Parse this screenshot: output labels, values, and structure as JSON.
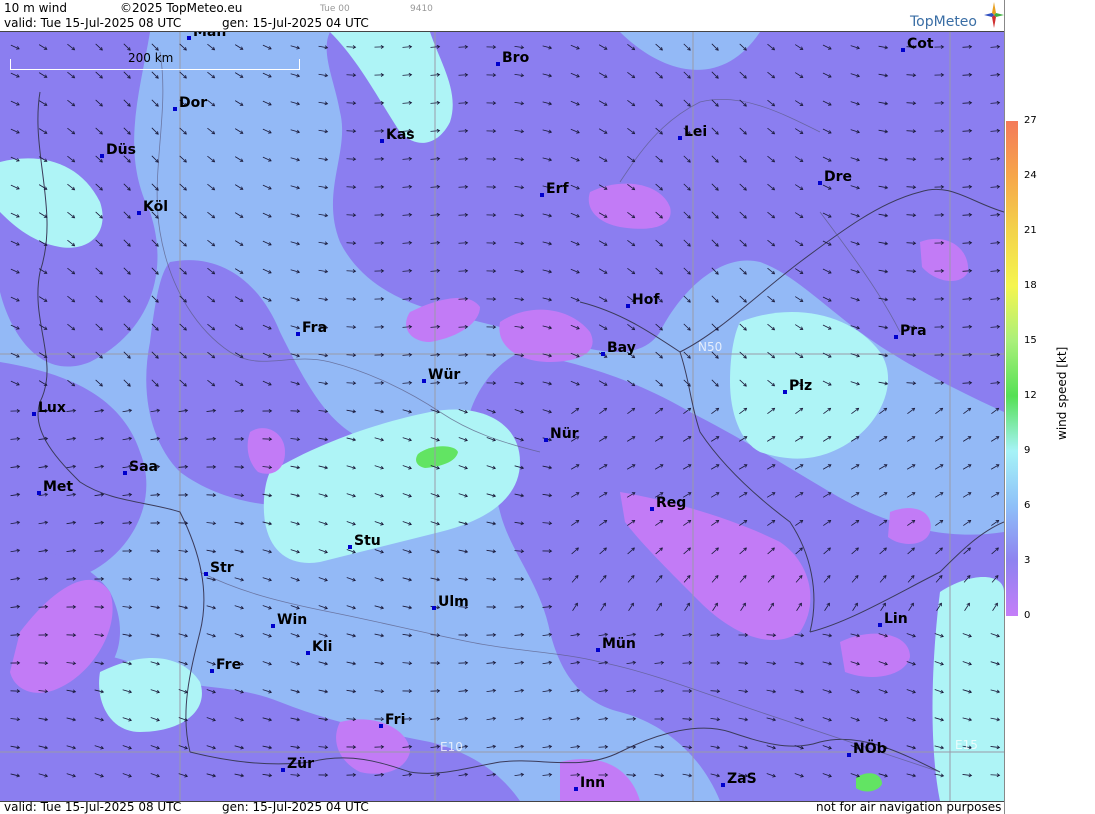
{
  "header": {
    "title": "10 m wind",
    "copyright": "©2025 TopMeteo.eu",
    "run": "Tue 00",
    "code": "9410",
    "valid": "valid:  Tue  15-Jul-2025  08 UTC",
    "gen": "gen: 15-Jul-2025 04 UTC"
  },
  "logo": {
    "text": "TopMeteo"
  },
  "footer": {
    "valid": "valid:  Tue  15-Jul-2025  08 UTC",
    "gen": "gen: 15-Jul-2025 04 UTC",
    "disclaimer": "not for air navigation purposes"
  },
  "scale_label": "200 km",
  "grid_labels": {
    "n50": "N50",
    "e10": "E10",
    "e15": "E15"
  },
  "cities": [
    {
      "name": "Man"
    },
    {
      "name": "Bro"
    },
    {
      "name": "Cot"
    },
    {
      "name": "Dor"
    },
    {
      "name": "Kas"
    },
    {
      "name": "Lei"
    },
    {
      "name": "Düs"
    },
    {
      "name": "Erf"
    },
    {
      "name": "Dre"
    },
    {
      "name": "Köl"
    },
    {
      "name": "Hof"
    },
    {
      "name": "Fra"
    },
    {
      "name": "Pra"
    },
    {
      "name": "Bay"
    },
    {
      "name": "Wür"
    },
    {
      "name": "Plz"
    },
    {
      "name": "Lux"
    },
    {
      "name": "Nür"
    },
    {
      "name": "Saa"
    },
    {
      "name": "Met"
    },
    {
      "name": "Reg"
    },
    {
      "name": "Stu"
    },
    {
      "name": "Str"
    },
    {
      "name": "Ulm"
    },
    {
      "name": "Win"
    },
    {
      "name": "Lin"
    },
    {
      "name": "Kli"
    },
    {
      "name": "Mün"
    },
    {
      "name": "Fre"
    },
    {
      "name": "Fri"
    },
    {
      "name": "NÖb"
    },
    {
      "name": "Zür"
    },
    {
      "name": "ZaS"
    },
    {
      "name": "Inn"
    }
  ],
  "legend": {
    "title": "wind  speed  [kt]",
    "ticks": [
      "27",
      "24",
      "21",
      "18",
      "15",
      "12",
      "9",
      "6",
      "3",
      "0"
    ],
    "colors": [
      "#f47a5a",
      "#f6a64a",
      "#f3d34a",
      "#f5f54e",
      "#aaf07a",
      "#55e055",
      "#a6f3f7",
      "#8ec0f8",
      "#8e82f0",
      "#c47ef8"
    ]
  },
  "map_colors": {
    "light_cyan": "#aef4f6",
    "light_blue": "#93b9f6",
    "blue_purple": "#8b7ef0",
    "violet": "#c27bf6",
    "green": "#62e463"
  }
}
